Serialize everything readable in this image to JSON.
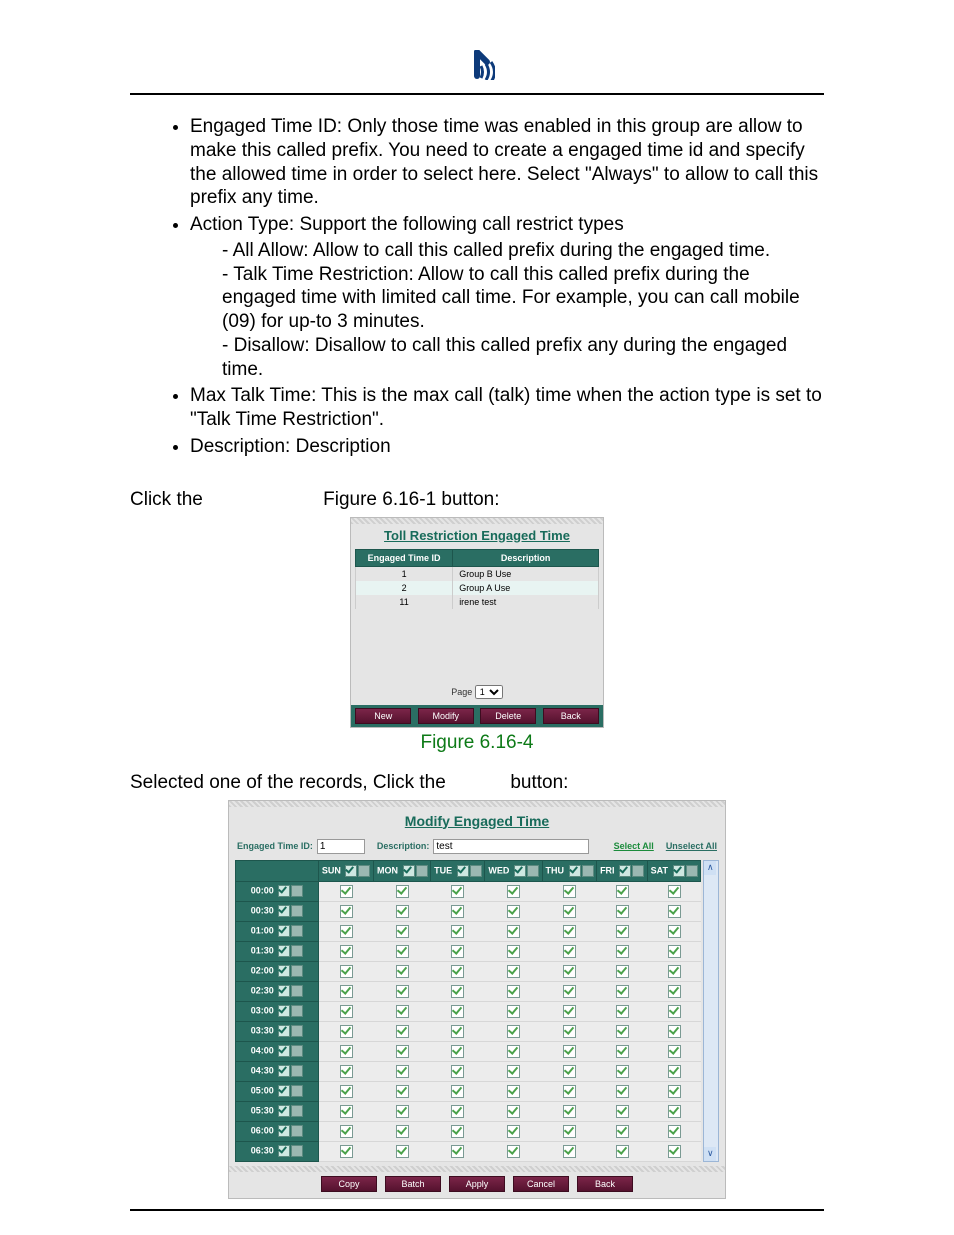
{
  "bullets": {
    "engaged_time_id": "Engaged Time ID: Only those time was enabled in this group are allow to make this called prefix. You need to create a engaged time id and specify the allowed time in order to select here. Select \"Always\" to allow to call this prefix any time.",
    "action_type_lead": "Action Type: Support the following call restrict types",
    "action_types": {
      "all_allow": "All Allow: Allow to call this called prefix during the engaged time.",
      "talk_time": "Talk Time Restriction: Allow to call this called prefix during the engaged time with limited call time. For example, you can call mobile (09) for up-to 3 minutes.",
      "disallow": "Disallow: Disallow to call this called prefix any during the engaged time."
    },
    "max_talk": "Max Talk Time: This is the max call (talk) time when the action type is set to \"Talk Time Restriction\".",
    "description": "Description: Description"
  },
  "click_line_left": "Click the",
  "click_line_right": "Figure 6.16-1  button:",
  "panel1": {
    "title": "Toll Restriction Engaged Time",
    "headers": {
      "id": "Engaged Time ID",
      "desc": "Description"
    },
    "rows": [
      {
        "id": "1",
        "desc": "Group B Use"
      },
      {
        "id": "2",
        "desc": "Group A Use"
      },
      {
        "id": "11",
        "desc": "irene test"
      }
    ],
    "page_label": "Page",
    "page_value": "1",
    "buttons": {
      "new": "New",
      "modify": "Modify",
      "delete": "Delete",
      "back": "Back"
    }
  },
  "figure_caption": "Figure 6.16-4",
  "selected_line_a": "Selected one of the records, Click the",
  "selected_line_b": "button:",
  "panel2": {
    "title": "Modify Engaged Time",
    "id_label": "Engaged Time ID:",
    "id_value": "1",
    "desc_label": "Description:",
    "desc_value": "test",
    "select_all": "Select All",
    "unselect_all": "Unselect All",
    "days": [
      "SUN",
      "MON",
      "TUE",
      "WED",
      "THU",
      "FRI",
      "SAT"
    ],
    "times": [
      "00:00",
      "00:30",
      "01:00",
      "01:30",
      "02:00",
      "02:30",
      "03:00",
      "03:30",
      "04:00",
      "04:30",
      "05:00",
      "05:30",
      "06:00",
      "06:30"
    ],
    "buttons": {
      "copy": "Copy",
      "batch": "Batch",
      "apply": "Apply",
      "cancel": "Cancel",
      "back": "Back"
    }
  }
}
